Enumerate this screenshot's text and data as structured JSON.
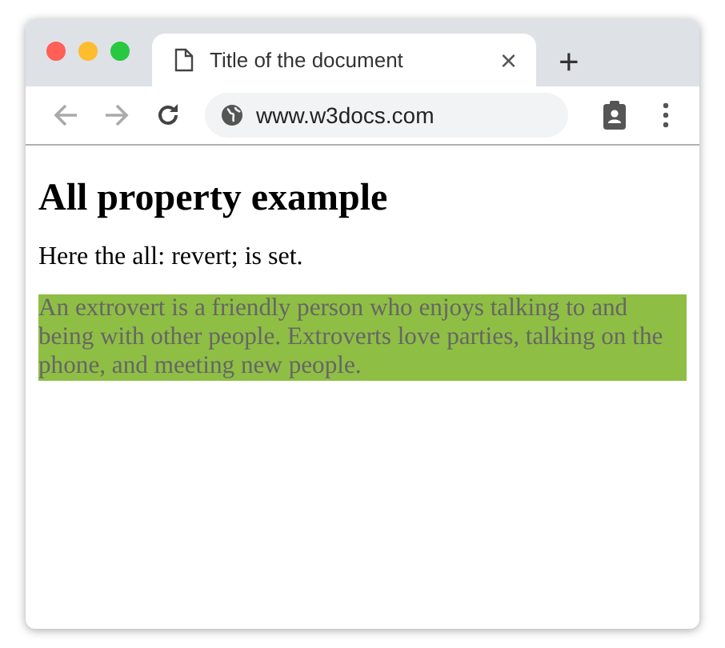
{
  "tab": {
    "title": "Title of the document",
    "close": "×"
  },
  "new_tab": "+",
  "address": {
    "url": "www.w3docs.com"
  },
  "nav": {
    "back_disabled": true,
    "forward_disabled": true
  },
  "page": {
    "heading": "All property example",
    "intro": "Here the all: revert; is set.",
    "highlight": "An extrovert is a friendly person who enjoys talking to and being with other people. Extroverts love parties, talking on the phone, and meeting new people."
  }
}
